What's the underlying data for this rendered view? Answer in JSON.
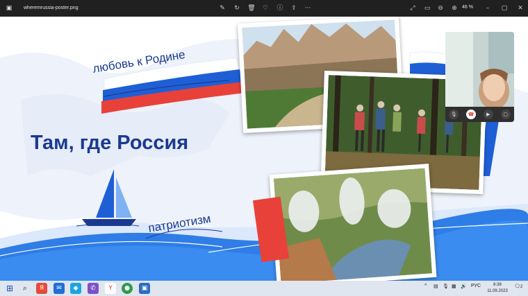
{
  "titlebar": {
    "filename": "wheremrussia-poster.png",
    "zoom": "46 %"
  },
  "poster": {
    "headline": "Там, где Россия",
    "tagline_top": "любовь к Родине",
    "tagline_bottom": "патриотизм",
    "colors": {
      "blue": "#1a3a8f",
      "flag_white": "#ffffff",
      "flag_blue": "#1f5fd6",
      "flag_red": "#e8413a",
      "wave": "#2f7de6"
    }
  },
  "call": {
    "controls": [
      "mic-icon",
      "hangup-icon",
      "camera-icon",
      "share-icon"
    ]
  },
  "taskbar": {
    "apps": [
      "start-icon",
      "search-icon",
      "yandex-icon",
      "mail-icon",
      "chat-icon",
      "viber-icon",
      "yandex-browser-icon",
      "chrome-icon",
      "photos-icon"
    ],
    "lang": "РУС",
    "time": "8:38",
    "date": "11.09.2023",
    "notifications": "2"
  }
}
